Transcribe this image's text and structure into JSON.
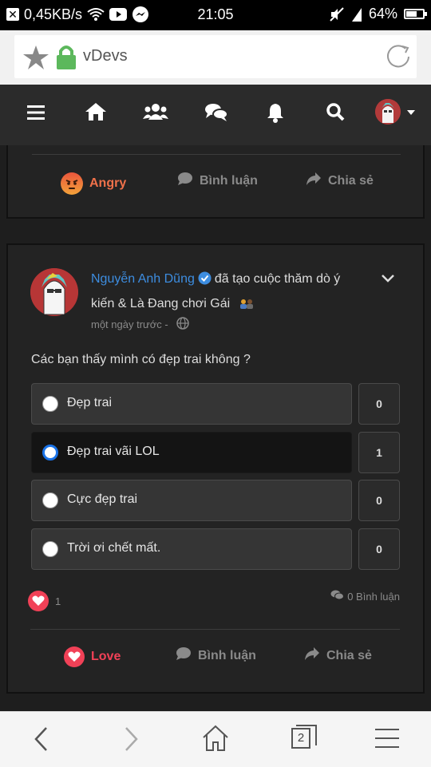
{
  "status_bar": {
    "speed": "0,45KB/s",
    "time": "21:05",
    "battery": "64%",
    "battery_level": 0.64,
    "icons": [
      "close-x-icon",
      "wifi-icon",
      "youtube-icon",
      "messenger-icon",
      "muted-icon",
      "signal-icon",
      "battery-icon"
    ]
  },
  "browser": {
    "url_text": "vDevs",
    "icons": [
      "star-icon",
      "lock-icon",
      "reload-icon"
    ]
  },
  "nav": {
    "icons": [
      "menu-icon",
      "home-icon",
      "friends-icon",
      "chat-icon",
      "bell-icon",
      "search-icon",
      "avatar",
      "caret-down-icon"
    ]
  },
  "prev_post": {
    "reaction_label": "Angry",
    "comment_label": "Bình luận",
    "share_label": "Chia sẻ"
  },
  "post": {
    "author": "Nguyễn Anh Dũng",
    "action_text": "đã tạo cuộc thăm dò ý kiến & Là Đang chơi Gái",
    "time": "một ngày trước -",
    "question": "Các bạn thấy mình có đẹp trai không ?",
    "options": [
      {
        "label": "Đẹp trai",
        "count": "0",
        "selected": false
      },
      {
        "label": "Đẹp trai vãi LOL",
        "count": "1",
        "selected": true
      },
      {
        "label": "Cực đẹp trai",
        "count": "0",
        "selected": false
      },
      {
        "label": "Trời ơi chết mất.",
        "count": "0",
        "selected": false
      }
    ],
    "reaction_count": "1",
    "comment_count": "0 Bình luận",
    "reaction_label": "Love",
    "comment_label": "Bình luận",
    "share_label": "Chia sẻ"
  },
  "bottom_bar": {
    "tab_count": "2",
    "icons": [
      "back-icon",
      "forward-icon",
      "home-icon",
      "tabs-icon",
      "menu-icon"
    ]
  },
  "colors": {
    "accent_blue": "#3d8de0",
    "love_red": "#f14157",
    "angry_orange": "#f0714a",
    "dark_bg": "#1e1e1e"
  }
}
